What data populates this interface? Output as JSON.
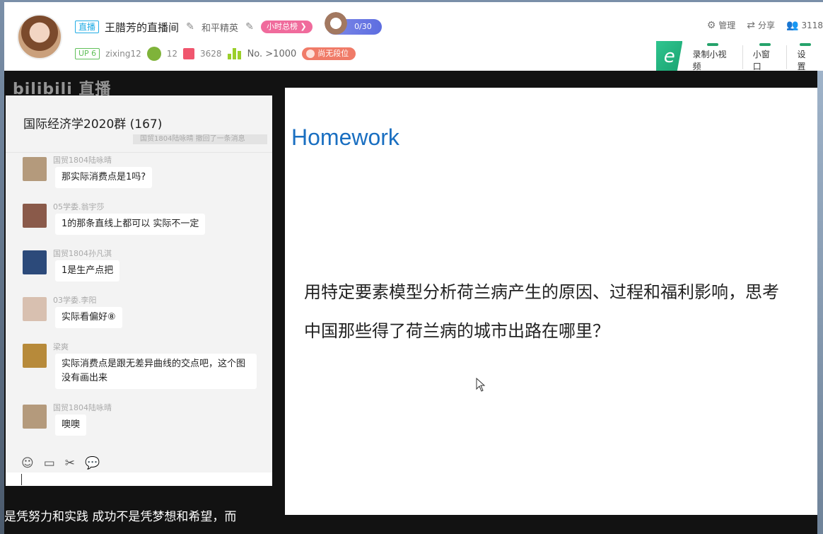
{
  "header": {
    "live_tag": "直播",
    "room_title": "王腊芳的直播间",
    "category": "和平精英",
    "rank_badge": "小时总榜 ❯",
    "fan_progress": "0/30",
    "up_level": "UP 6",
    "username": "zixing12",
    "stat_1": "12",
    "gift_count": "3628",
    "rank_text": "No. >1000",
    "tier_badge": "尚无段位",
    "actions": {
      "manage": "管理",
      "share": "分享",
      "viewers": "3118"
    },
    "tools": {
      "record": "录制小视频",
      "mini": "小窗口",
      "settings": "设置"
    }
  },
  "video": {
    "logo": "bilibili 直播",
    "subtitle": "是凭努力和实践 成功不是凭梦想和希望，而"
  },
  "chat": {
    "title": "国际经济学2020群 (167)",
    "notice": "国贸1804陆咏晴 撤回了一条消息",
    "messages": [
      {
        "name": "国贸1804陆咏晴",
        "text": "那实际消费点是1吗?"
      },
      {
        "name": "05学委.翁宇莎",
        "text": "1的那条直线上都可以 实际不一定"
      },
      {
        "name": "国贸1804孙凡淇",
        "text": "1是生产点把"
      },
      {
        "name": "03学委.李阳",
        "text": "实际看偏好⑧"
      },
      {
        "name": "梁爽",
        "text": "实际消费点是跟无差异曲线的交点吧，这个图没有画出来"
      },
      {
        "name": "国贸1804陆咏晴",
        "text": "噢噢"
      }
    ],
    "toolbar_icons": [
      "emoji-icon",
      "folder-icon",
      "scissors-icon",
      "chat-bubble-icon"
    ]
  },
  "slide": {
    "title": "Homework",
    "body": "用特定要素模型分析荷兰病产生的原因、过程和福利影响，思考中国那些得了荷兰病的城市出路在哪里？"
  }
}
